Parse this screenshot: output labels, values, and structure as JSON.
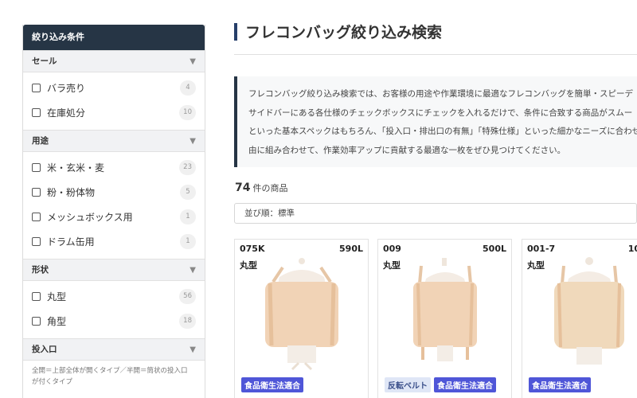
{
  "sidebar": {
    "title": "絞り込み条件",
    "sections": [
      {
        "title": "セール",
        "caret": "▼",
        "options": [
          {
            "label": "バラ売り",
            "count": "4"
          },
          {
            "label": "在庫処分",
            "count": "10"
          }
        ]
      },
      {
        "title": "用途",
        "caret": "▼",
        "options": [
          {
            "label": "米・玄米・麦",
            "count": "23"
          },
          {
            "label": "粉・粉体物",
            "count": "5"
          },
          {
            "label": "メッシュボックス用",
            "count": "1"
          },
          {
            "label": "ドラム缶用",
            "count": "1"
          }
        ]
      },
      {
        "title": "形状",
        "caret": "▼",
        "options": [
          {
            "label": "丸型",
            "count": "56"
          },
          {
            "label": "角型",
            "count": "18"
          }
        ]
      },
      {
        "title": "投入口",
        "caret": "▼",
        "note_line1": "全開＝上部全体が開くタイプ／半開＝筒状の投入口",
        "note_line2": "が付くタイプ"
      }
    ]
  },
  "main": {
    "title": "フレコンバッグ絞り込み検索",
    "intro": [
      "フレコンバッグ絞り込み検索では、お客様の用途や作業環境に最適なフレコンバッグを簡単・スピーデ",
      "サイドバーにある各仕様のチェックボックスにチェックを入れるだけで、条件に合致する商品がスムー",
      "といった基本スペックはもちろん、「投入口・排出口の有無」「特殊仕様」といった細かなニーズに合わせ",
      "由に組み合わせて、作業効率アップに貢献する最適な一枚をぜひ見つけてください。"
    ],
    "result_count": "74",
    "result_suffix": "件の商品",
    "sort_label": "並び順：標準"
  },
  "products": [
    {
      "code": "075K",
      "capacity": "590L",
      "shape": "丸型",
      "tags": [
        "食品衛生法適合"
      ]
    },
    {
      "code": "009",
      "capacity": "500L",
      "shape": "丸型",
      "tags": [
        "反転ベルト",
        "食品衛生法適合"
      ]
    },
    {
      "code": "001-7",
      "capacity": "10",
      "shape": "丸型",
      "tags": [
        "食品衛生法適合"
      ]
    }
  ],
  "colors": {
    "header_navy": "#263545",
    "food_tag": "#4f56d8",
    "belt_tag_bg": "#dfe6f6",
    "bag_body": "#f1d3b6"
  }
}
